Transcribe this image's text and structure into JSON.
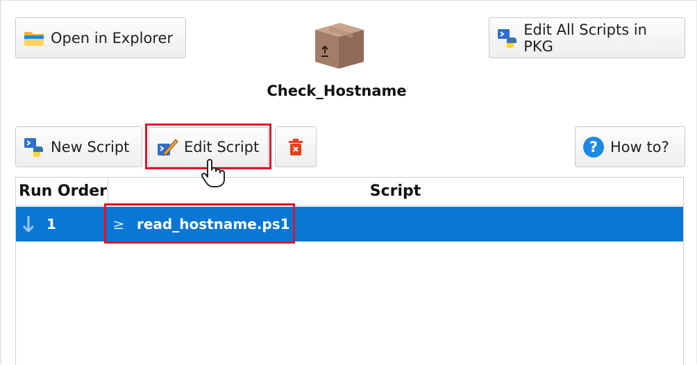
{
  "toolbar_top": {
    "open_explorer_label": "Open in Explorer",
    "edit_all_label": "Edit All Scripts in PKG"
  },
  "package": {
    "name": "Check_Hostname",
    "icon": "package-box-icon"
  },
  "toolbar_scripts": {
    "new_script_label": "New Script",
    "edit_script_label": "Edit Script",
    "delete_icon": "trash-icon",
    "how_to_label": "How to?"
  },
  "table": {
    "columns": [
      "Run Order",
      "Script"
    ],
    "rows": [
      {
        "order": "1",
        "script": "read_hostname.ps1"
      }
    ]
  },
  "colors": {
    "selection": "#0a77d5",
    "highlight": "#e0142a",
    "delete_red": "#e8401c",
    "help_blue": "#1e88e5"
  }
}
